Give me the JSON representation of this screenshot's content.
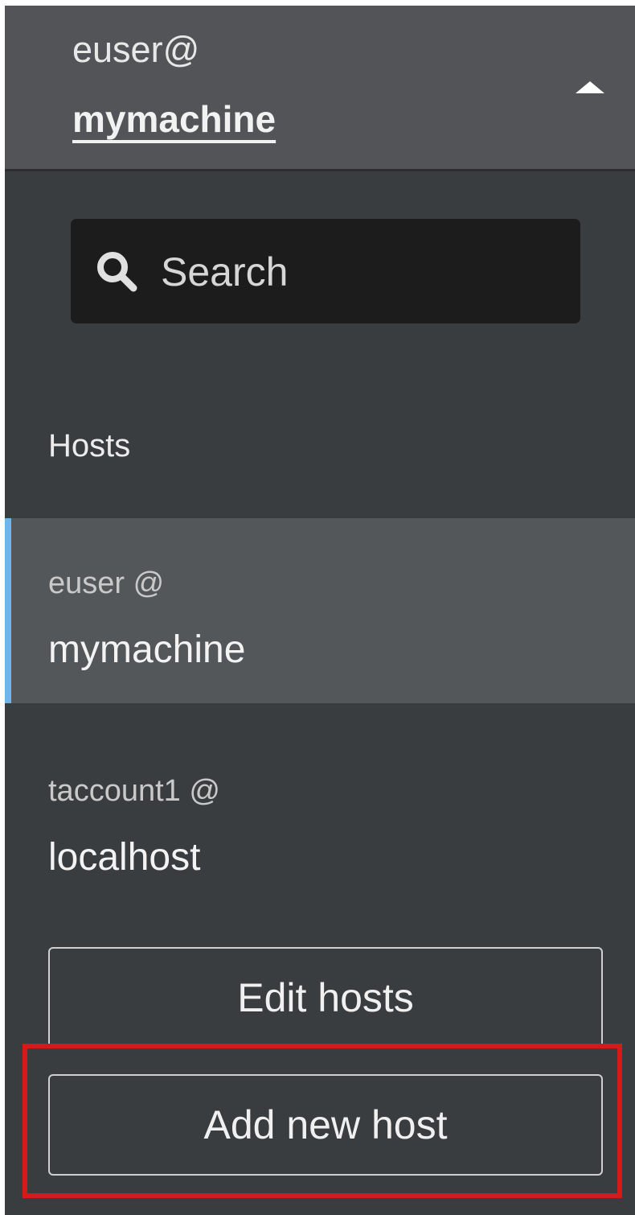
{
  "header": {
    "user": "euser@",
    "host": "mymachine",
    "toggle_icon": "caret-up-icon"
  },
  "search": {
    "placeholder": "Search",
    "value": "",
    "icon": "search-icon"
  },
  "hosts": {
    "section_label": "Hosts",
    "items": [
      {
        "user": "euser @",
        "host": "mymachine",
        "active": true
      },
      {
        "user": "taccount1 @",
        "host": "localhost",
        "active": false
      }
    ]
  },
  "actions": {
    "edit_label": "Edit hosts",
    "add_label": "Add new host"
  },
  "colors": {
    "panel_bg": "#3a3d40",
    "header_bg": "#525457",
    "active_item_bg": "#54575a",
    "active_indicator": "#6cb6e8",
    "search_bg": "#1c1c1c",
    "highlight": "#d41a1a"
  }
}
